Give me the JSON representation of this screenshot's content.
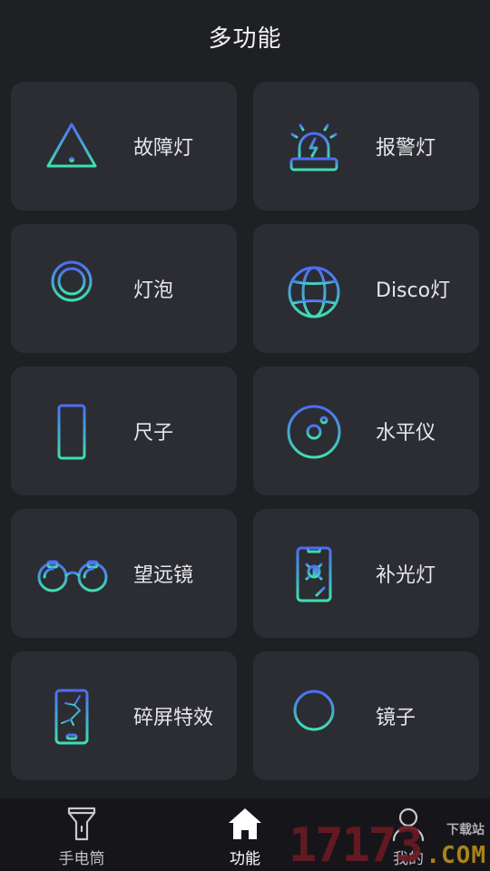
{
  "header": {
    "title": "多功能"
  },
  "features": [
    {
      "label": "故障灯",
      "icon": "warning-triangle-icon"
    },
    {
      "label": "报警灯",
      "icon": "alarm-siren-icon"
    },
    {
      "label": "灯泡",
      "icon": "light-bulb-icon"
    },
    {
      "label": "Disco灯",
      "icon": "disco-ball-icon"
    },
    {
      "label": "尺子",
      "icon": "ruler-icon"
    },
    {
      "label": "水平仪",
      "icon": "level-gauge-icon"
    },
    {
      "label": "望远镜",
      "icon": "binoculars-icon"
    },
    {
      "label": "补光灯",
      "icon": "fill-light-phone-icon"
    },
    {
      "label": "碎屏特效",
      "icon": "cracked-phone-icon"
    },
    {
      "label": "镜子",
      "icon": "mirror-icon"
    }
  ],
  "tabbar": {
    "tabs": [
      {
        "label": "手电筒",
        "icon": "flashlight-icon",
        "active": false
      },
      {
        "label": "功能",
        "icon": "home-icon",
        "active": true
      },
      {
        "label": "我的",
        "icon": "user-icon",
        "active": false
      }
    ]
  },
  "watermark": {
    "number": "17173",
    "site": "下载站",
    "domain": ".COM"
  },
  "colors": {
    "background": "#1f2024",
    "card": "#2b2d33",
    "icon_gradient_start": "#4d6cf5",
    "icon_gradient_end": "#3ee0b0",
    "tabbar": "#16161a"
  }
}
